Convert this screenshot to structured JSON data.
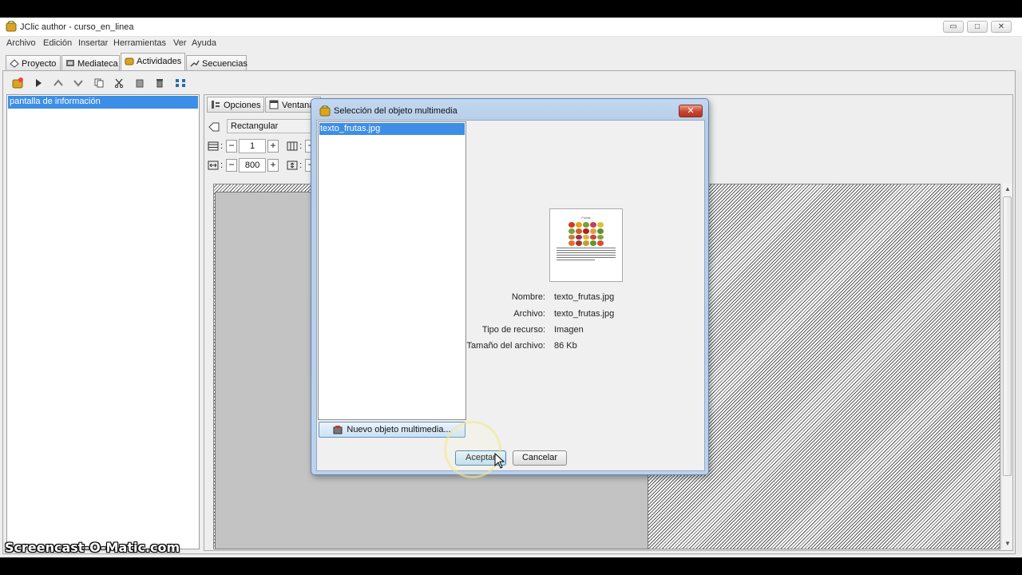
{
  "window": {
    "title": "JClic author - curso_en_linea",
    "controls": {
      "minimize": "▭",
      "maximize": "□",
      "close": "✕"
    }
  },
  "menu": [
    "Archivo",
    "Edición",
    "Insertar",
    "Herramientas",
    "Ver",
    "Ayuda"
  ],
  "main_tabs": [
    {
      "label": "Proyecto",
      "icon": "project-icon"
    },
    {
      "label": "Mediateca",
      "icon": "media-library-icon"
    },
    {
      "label": "Actividades",
      "icon": "activities-icon",
      "active": true
    },
    {
      "label": "Secuencias",
      "icon": "sequences-icon"
    }
  ],
  "toolbar_icons": [
    "new-activity-icon",
    "play-icon",
    "move-up-icon",
    "move-down-icon",
    "copy-icon",
    "cut-icon",
    "paste-icon",
    "delete-icon",
    "layout-icon"
  ],
  "activity_list": {
    "selected": "pantalla de información"
  },
  "editor": {
    "sub_tabs": [
      {
        "label": "Opciones",
        "icon": "options-icon"
      },
      {
        "label": "Ventana",
        "icon": "window-icon"
      }
    ],
    "shape": "Rectangular",
    "rows_value": "1",
    "width_value": "800"
  },
  "dialog": {
    "title": "Selección del objeto multimedia",
    "close_label": "✕",
    "list_selected": "texto_frutas.jpg",
    "new_button": "Nuevo objeto multimedia...",
    "preview": {
      "heading": "Frutas"
    },
    "info": [
      {
        "label": "Nombre:",
        "value": "texto_frutas.jpg"
      },
      {
        "label": "Archivo:",
        "value": "texto_frutas.jpg"
      },
      {
        "label": "Tipo de recurso:",
        "value": "Imagen"
      },
      {
        "label": "Tamaño del archivo:",
        "value": "86 Kb"
      }
    ],
    "accept": "Aceptar",
    "cancel": "Cancelar"
  },
  "watermark": "Screencast-O-Matic.com"
}
